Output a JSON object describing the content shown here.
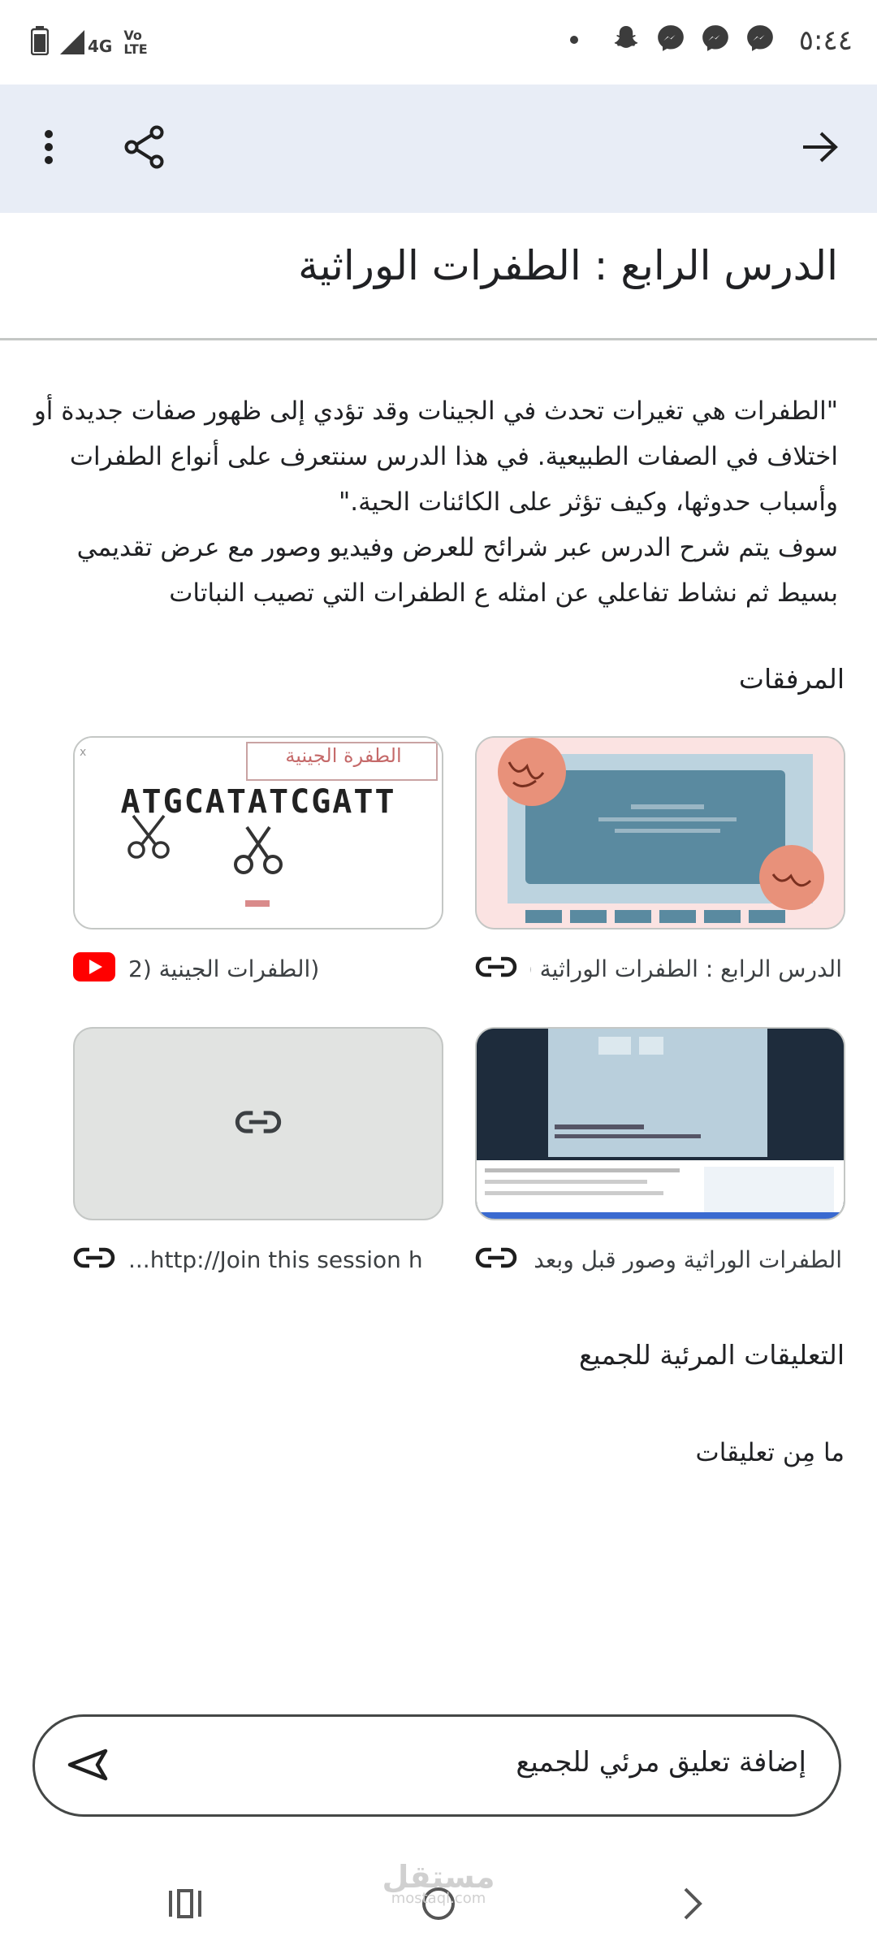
{
  "status_bar": {
    "time": "٥:٤٤",
    "network": "4G",
    "volte": "Vo LTE",
    "notification_icons": [
      "messenger-icon",
      "messenger-icon",
      "messenger-icon",
      "snapchat-icon",
      "dot-icon"
    ]
  },
  "app_bar": {
    "back_icon": "arrow-right-icon",
    "share_icon": "share-icon",
    "more_icon": "more-vertical-icon"
  },
  "lesson": {
    "title": "الدرس الرابع : الطفرات الوراثية",
    "description_lines": [
      "\"الطفرات هي تغيرات تحدث في الجينات وقد تؤدي إلى ظهور صفات جديدة أو",
      "اختلاف في الصفات الطبيعية. في هذا الدرس سنتعرف على أنواع الطفرات",
      "وأسباب حدوثها، وكيف تؤثر على الكائنات الحية.\"",
      "سوف يتم شرح الدرس عبر شرائح للعرض  وفيديو وصور  مع عرض تقديمي",
      "بسيط ثم نشاط تفاعلي عن امثله ع الطفرات التي تصيب النباتات"
    ]
  },
  "attachments": {
    "heading": "المرفقات",
    "items": [
      {
        "label": "الدرس الرابع : الطفرات الوراثية (...",
        "icon": "link-icon"
      },
      {
        "label": "(الطفرات الجينية (2",
        "icon": "youtube-icon",
        "thumb_banner": "الطفرة الجينية",
        "thumb_sequence": "ATGCATATCGATT"
      },
      {
        "label": "الطفرات الوراثية وصور قبل وبعد ...",
        "icon": "link-icon"
      },
      {
        "label": "...http://Join this session h",
        "icon": "link-icon"
      }
    ]
  },
  "comments": {
    "heading": "التعليقات المرئية للجميع",
    "empty_text": "ما مِن تعليقات",
    "input_placeholder": "إضافة تعليق مرئي للجميع"
  },
  "nav_bar": {
    "recents_icon": "recents-icon",
    "home_icon": "home-icon",
    "back_icon": "back-chevron-icon"
  },
  "watermark": {
    "ar": "مستقل",
    "en": "mostaql.com"
  },
  "colors": {
    "app_bar_bg": "#e8edf6",
    "youtube_red": "#ff0000",
    "slide_blue": "#4f7e96",
    "slide_pink": "#f8d7d5"
  }
}
